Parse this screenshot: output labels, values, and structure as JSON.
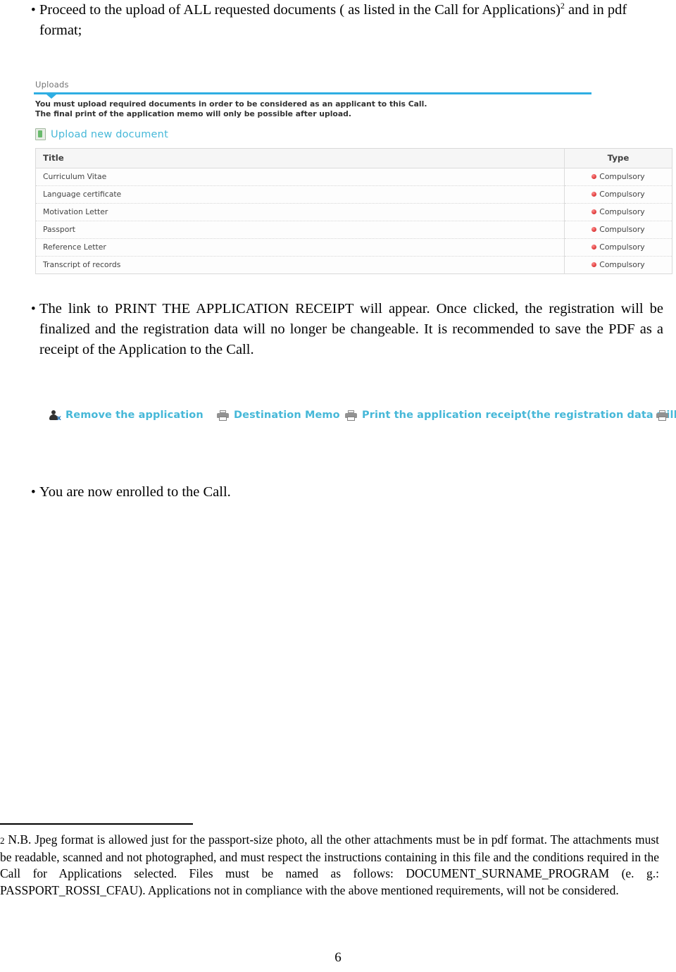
{
  "document": {
    "page_number": "6",
    "bullets": [
      {
        "marker": "•",
        "text": "Proceed to the upload of ALL requested documents ( as listed in the Call for Applications)",
        "superscript": "2",
        "text_tail": " and in pdf format;"
      },
      {
        "marker": "•",
        "text": "The link to PRINT THE APPLICATION RECEIPT will appear. Once clicked, the registration will be finalized and the registration data will no longer be changeable. It is recommended to save the PDF as a receipt of the Application to the Call."
      },
      {
        "marker": "•",
        "text": "You are now enrolled to the Call."
      }
    ],
    "footnote": {
      "marker": "2",
      "text": " N.B. Jpeg format is allowed just for the passport-size photo, all the other attachments must be in pdf format.  The attachments must be readable, scanned and not photographed, and must respect the instructions containing in this file and the conditions required in the Call for Applications selected. Files must be named as follows: DOCUMENT_SURNAME_PROGRAM (e. g.: PASSPORT_ROSSI_CFAU). Applications not in compliance with the above mentioned requirements, will not be considered."
    }
  },
  "uploads_panel": {
    "tab_label": "Uploads",
    "accent_color": "#27ace3",
    "link_color": "#3fb6d8",
    "note_line_1": "You must upload required documents in order to be considered as an applicant to this Call.",
    "note_line_2": "The final print of the application memo will only be possible after upload.",
    "upload_link_label": "Upload new document",
    "upload_icon": "document-upload-icon",
    "table": {
      "columns": [
        "Title",
        "Type"
      ],
      "rows": [
        {
          "title": "Curriculum Vitae",
          "type": "Compulsory"
        },
        {
          "title": "Language certificate",
          "type": "Compulsory"
        },
        {
          "title": "Motivation Letter",
          "type": "Compulsory"
        },
        {
          "title": "Passport",
          "type": "Compulsory"
        },
        {
          "title": "Reference Letter",
          "type": "Compulsory"
        },
        {
          "title": "Transcript of records",
          "type": "Compulsory"
        }
      ],
      "type_marker_color": "#e23b3b"
    }
  },
  "action_toolbar": {
    "actions": [
      {
        "icon": "remove-user-icon",
        "label": "Remove the application"
      },
      {
        "icon": "printer-icon",
        "label": "Destination Memo"
      },
      {
        "icon": "printer-icon",
        "label": "Print the application receipt(the registration data will no longer be changeable)"
      }
    ],
    "trailing_icon": "printer-icon"
  }
}
